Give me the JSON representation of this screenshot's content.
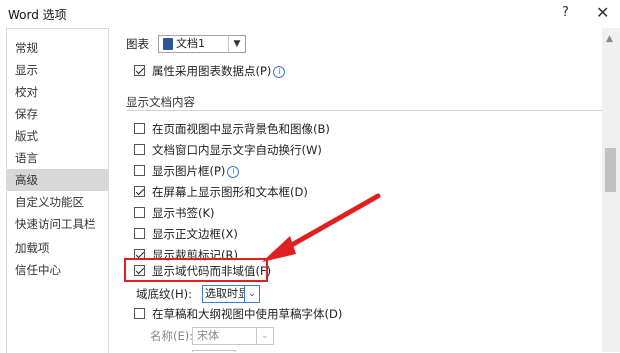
{
  "window": {
    "title": "Word 选项",
    "help": "?",
    "close": "✕"
  },
  "sidebar": {
    "items": [
      {
        "label": "常规"
      },
      {
        "label": "显示"
      },
      {
        "label": "校对"
      },
      {
        "label": "保存"
      },
      {
        "label": "版式"
      },
      {
        "label": "语言"
      },
      {
        "label": "高级",
        "active": true
      },
      {
        "label": "自定义功能区"
      },
      {
        "label": "快速访问工具栏"
      },
      {
        "label": "加载项"
      },
      {
        "label": "信任中心"
      }
    ]
  },
  "chart_row": {
    "label": "图表",
    "select_value": "文档1"
  },
  "chart_options": {
    "property_label": "属性采用图表数据点(P)",
    "property_checked": true
  },
  "doc_content": {
    "section_title": "显示文档内容",
    "options": [
      {
        "label": "在页面视图中显示背景色和图像(B)",
        "checked": false
      },
      {
        "label": "文档窗口内显示文字自动换行(W)",
        "checked": false
      },
      {
        "label": "显示图片框(P)",
        "checked": false,
        "info": true
      },
      {
        "label": "在屏幕上显示图形和文本框(D)",
        "checked": true
      },
      {
        "label": "显示书签(K)",
        "checked": false
      },
      {
        "label": "显示正文边框(X)",
        "checked": false
      },
      {
        "label": "显示裁剪标记(R)",
        "checked": true
      },
      {
        "label": "显示域代码而非域值(F)",
        "checked": true
      }
    ],
    "field_shading_label": "域底纹(H):",
    "field_shading_value": "选取时显示",
    "draft_font_label": "在草稿和大纲视图中使用草稿字体(D)",
    "draft_font_checked": false,
    "name_label": "名称(E):",
    "name_value": "宋体"
  },
  "colors": {
    "highlight": "#e02020",
    "active_sidebar": "#d8d8d8"
  }
}
